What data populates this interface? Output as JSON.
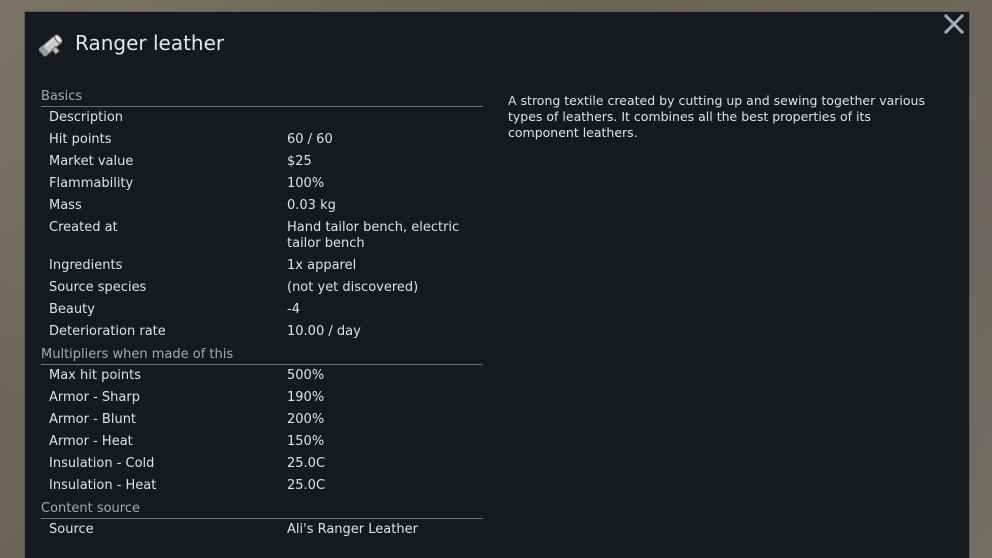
{
  "window": {
    "title": "Ranger leather",
    "icon": "leather-roll-icon",
    "close_icon": "close-icon"
  },
  "description": "A strong textile created by cutting up and sewing together various types of leathers. It combines all the best properties of its component leathers.",
  "sections": [
    {
      "header": "Basics",
      "rows": [
        {
          "label": "Description",
          "value": ""
        },
        {
          "label": "Hit points",
          "value": "60 / 60"
        },
        {
          "label": "Market value",
          "value": "$25"
        },
        {
          "label": "Flammability",
          "value": "100%"
        },
        {
          "label": "Mass",
          "value": "0.03 kg"
        },
        {
          "label": "Created at",
          "value": "Hand tailor bench, electric tailor bench"
        },
        {
          "label": "Ingredients",
          "value": "1x apparel"
        },
        {
          "label": "Source species",
          "value": "(not yet discovered)"
        },
        {
          "label": "Beauty",
          "value": "-4"
        },
        {
          "label": "Deterioration rate",
          "value": "10.00 / day"
        }
      ]
    },
    {
      "header": "Multipliers when made of this",
      "rows": [
        {
          "label": "Max hit points",
          "value": "500%"
        },
        {
          "label": "Armor - Sharp",
          "value": "190%"
        },
        {
          "label": "Armor - Blunt",
          "value": "200%"
        },
        {
          "label": "Armor - Heat",
          "value": "150%"
        },
        {
          "label": "Insulation - Cold",
          "value": "25.0C"
        },
        {
          "label": "Insulation - Heat",
          "value": "25.0C"
        }
      ]
    },
    {
      "header": "Content source",
      "rows": [
        {
          "label": "Source",
          "value": "Ali's Ranger Leather"
        }
      ]
    }
  ]
}
